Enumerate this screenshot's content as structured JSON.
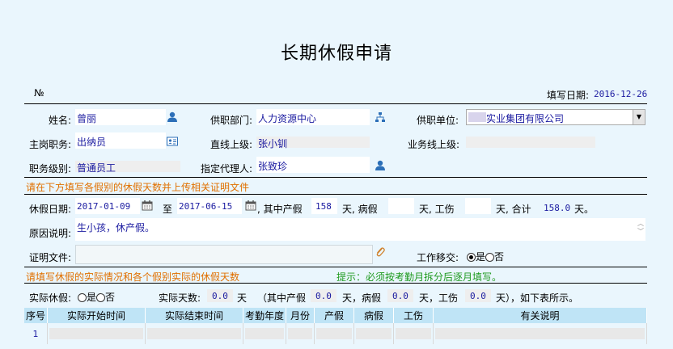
{
  "title": "长期休假申请",
  "header": {
    "no_label": "№",
    "fill_date_label": "填写日期:",
    "fill_date": "2016-12-26"
  },
  "row1": {
    "name_label": "姓名:",
    "name": "曾丽",
    "dept_label": "供职部门:",
    "dept": "人力资源中心",
    "unit_label": "供职单位:",
    "unit": "实业集团有限公司"
  },
  "row2": {
    "post_label": "主岗职务:",
    "post": "出纳员",
    "line_sup_label": "直线上级:",
    "line_sup": "张小钏",
    "biz_sup_label": "业务线上级:"
  },
  "row3": {
    "level_label": "职务级别:",
    "level": "普通员工",
    "agent_label": "指定代理人:",
    "agent": "张致珍"
  },
  "hint1": "请在下方填写各假别的休假天数并上传相关证明文件",
  "leave": {
    "date_label": "休假日期:",
    "start": "2017-01-09",
    "to": "至",
    "end": "2017-06-15",
    "maternity_label": ", 其中产假",
    "maternity": "158",
    "day1": "天, 病假",
    "day2": "天, 工伤",
    "day3": "天, 合计",
    "total": "158.0",
    "day_end": "天。"
  },
  "reason": {
    "label": "原因说明:",
    "value": "生小孩，休产假。"
  },
  "proof": {
    "label": "证明文件:",
    "handover_label": "工作移交:",
    "yes": "是",
    "no": "否"
  },
  "hint2": "请填写休假的实际情况和各个假别实际的休假天数",
  "hint2_note": "提示：必须按考勤月拆分后逐月填写。",
  "actual": {
    "label": "实际休假:",
    "yes": "是",
    "no": "否",
    "days_label": "实际天数:",
    "days": "0.0",
    "unit": "天",
    "maternity_label": "（其中产假",
    "maternity": "0.0",
    "sick_label": "天，病假",
    "sick": "0.0",
    "injury_label": "天，工伤",
    "injury": "0.0",
    "tail": "天），如下表所示。"
  },
  "table": {
    "headers": [
      "序号",
      "实际开始时间",
      "实际结束时间",
      "考勤年度",
      "月份",
      "产假",
      "病假",
      "工伤",
      "有关说明"
    ],
    "rows": [
      {
        "no": "1"
      }
    ]
  },
  "colors": {
    "background": "#eaf6fd",
    "header_bg": "#bfe4f6",
    "hint": "#e07000",
    "note": "#1e9a1e",
    "value": "#1a1aa0"
  },
  "icons": [
    "person-icon",
    "org-chart-icon",
    "id-card-icon",
    "calendar-icon",
    "paperclip-icon",
    "dropdown-arrow-icon"
  ]
}
